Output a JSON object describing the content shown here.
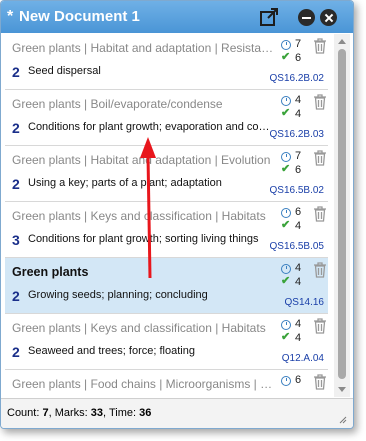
{
  "window": {
    "unsaved_marker": "*",
    "title": "New Document 1"
  },
  "items": [
    {
      "category": "Green plants | Habitat and adaptation | Resistance",
      "marks": "2",
      "description": "Seed dispersal",
      "time": "7",
      "count": "6",
      "code": "QS16.2B.02",
      "selected": false
    },
    {
      "category": "Green plants | Boil/evaporate/condense",
      "marks": "2",
      "description": "Conditions for plant growth; evaporation and condensation",
      "time": "4",
      "count": "4",
      "code": "QS16.2B.03",
      "selected": false
    },
    {
      "category": "Green plants | Habitat and adaptation | Evolution",
      "marks": "2",
      "description": "Using a key; parts of a plant; adaptation",
      "time": "7",
      "count": "6",
      "code": "QS16.5B.02",
      "selected": false
    },
    {
      "category": "Green plants | Keys and classification | Habitats",
      "marks": "3",
      "description": "Conditions for plant growth; sorting living things",
      "time": "6",
      "count": "4",
      "code": "QS16.5B.05",
      "selected": false
    },
    {
      "category": "Green plants",
      "marks": "2",
      "description": "Growing seeds; planning; concluding",
      "time": "4",
      "count": "4",
      "code": "QS14.16",
      "selected": true
    },
    {
      "category": "Green plants | Keys and classification | Habitats",
      "marks": "2",
      "description": "Seaweed and trees; force; floating",
      "time": "4",
      "count": "4",
      "code": "Q12.A.04",
      "selected": false
    },
    {
      "category": "Green plants | Food chains | Microorganisms | Habitats",
      "marks": "",
      "description": "",
      "time": "6",
      "count": "",
      "code": "",
      "selected": false
    }
  ],
  "status": {
    "count_label": "Count:",
    "count_value": "7",
    "marks_label": "Marks:",
    "marks_value": "33",
    "time_label": "Time:",
    "time_value": "36"
  },
  "icons": {
    "popout": "popout-icon",
    "minimize": "minimize-icon",
    "close": "close-icon",
    "clock": "clock-icon",
    "check": "check-icon",
    "trash": "trash-icon"
  },
  "colors": {
    "titlebar": "#4a95d6",
    "selected_row": "#d3e7f6",
    "marks": "#1a2f8a",
    "code": "#1a3fa8",
    "arrow": "#e8161c"
  }
}
